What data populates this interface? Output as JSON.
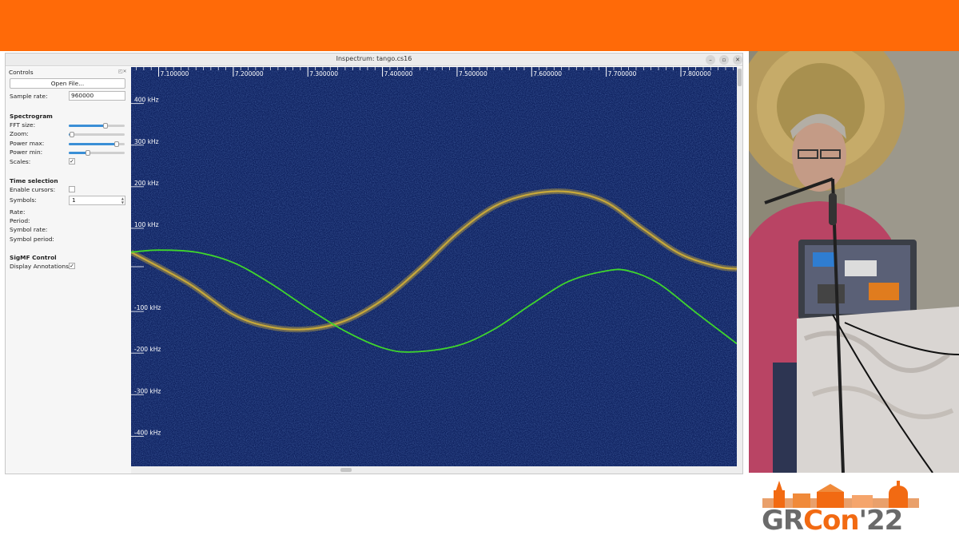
{
  "window": {
    "title": "Inspectrum: tango.cs16",
    "min": "–",
    "max": "▫",
    "close": "✕"
  },
  "controls": {
    "title": "Controls",
    "dock_icons": "◰✕",
    "open_file": "Open File...",
    "sample_rate_label": "Sample rate:",
    "sample_rate_value": "960000",
    "spectrogram_heading": "Spectrogram",
    "fft_size_label": "FFT size:",
    "fft_size_level": 0.66,
    "zoom_label": "Zoom:",
    "zoom_level": 0.06,
    "power_max_label": "Power max:",
    "power_max_level": 0.86,
    "power_min_label": "Power min:",
    "power_min_level": 0.34,
    "scales_label": "Scales:",
    "scales_checked": "✓",
    "time_heading": "Time selection",
    "enable_cursors_label": "Enable cursors:",
    "enable_cursors_checked": "",
    "symbols_label": "Symbols:",
    "symbols_value": "1",
    "rate_label": "Rate:",
    "period_label": "Period:",
    "symbol_rate_label": "Symbol rate:",
    "symbol_period_label": "Symbol period:",
    "sigmf_heading": "SigMF Control",
    "display_annotations_label": "Display Annotations:",
    "display_annotations_checked": "✓"
  },
  "spectrogram": {
    "time_ticks": [
      "7.100000",
      "7.200000",
      "7.300000",
      "7.400000",
      "7.500000",
      "7.600000",
      "7.700000",
      "7.800000"
    ],
    "time_tick_values": [
      7.1,
      7.2,
      7.3,
      7.4,
      7.5,
      7.6,
      7.7,
      7.8
    ],
    "time_range": [
      7.063,
      7.875
    ],
    "freq_ticks": [
      "400 kHz",
      "300 kHz",
      "200 kHz",
      "100 kHz",
      "-100 kHz",
      "-200 kHz",
      "-300 kHz",
      "-400 kHz"
    ],
    "freq_tick_values": [
      400,
      300,
      200,
      100,
      -100,
      -200,
      -300,
      -400
    ],
    "freq_range_khz": [
      -480,
      480
    ],
    "background_color": "#0f2260",
    "yellow_trace": {
      "color": "#c7a83a",
      "points": [
        [
          7.063,
          35
        ],
        [
          7.14,
          -40
        ],
        [
          7.2,
          -115
        ],
        [
          7.25,
          -145
        ],
        [
          7.3,
          -150
        ],
        [
          7.35,
          -130
        ],
        [
          7.4,
          -80
        ],
        [
          7.45,
          -5
        ],
        [
          7.5,
          80
        ],
        [
          7.55,
          145
        ],
        [
          7.6,
          175
        ],
        [
          7.65,
          180
        ],
        [
          7.7,
          155
        ],
        [
          7.75,
          90
        ],
        [
          7.8,
          30
        ],
        [
          7.85,
          0
        ],
        [
          7.875,
          -5
        ]
      ]
    },
    "green_trace": {
      "color": "#3fd62c",
      "points": [
        [
          7.063,
          35
        ],
        [
          7.1,
          40
        ],
        [
          7.15,
          35
        ],
        [
          7.2,
          10
        ],
        [
          7.25,
          -40
        ],
        [
          7.3,
          -100
        ],
        [
          7.35,
          -155
        ],
        [
          7.4,
          -195
        ],
        [
          7.44,
          -205
        ],
        [
          7.5,
          -190
        ],
        [
          7.55,
          -150
        ],
        [
          7.6,
          -90
        ],
        [
          7.65,
          -35
        ],
        [
          7.7,
          -10
        ],
        [
          7.73,
          -10
        ],
        [
          7.77,
          -40
        ],
        [
          7.82,
          -110
        ],
        [
          7.875,
          -185
        ]
      ]
    }
  }
}
